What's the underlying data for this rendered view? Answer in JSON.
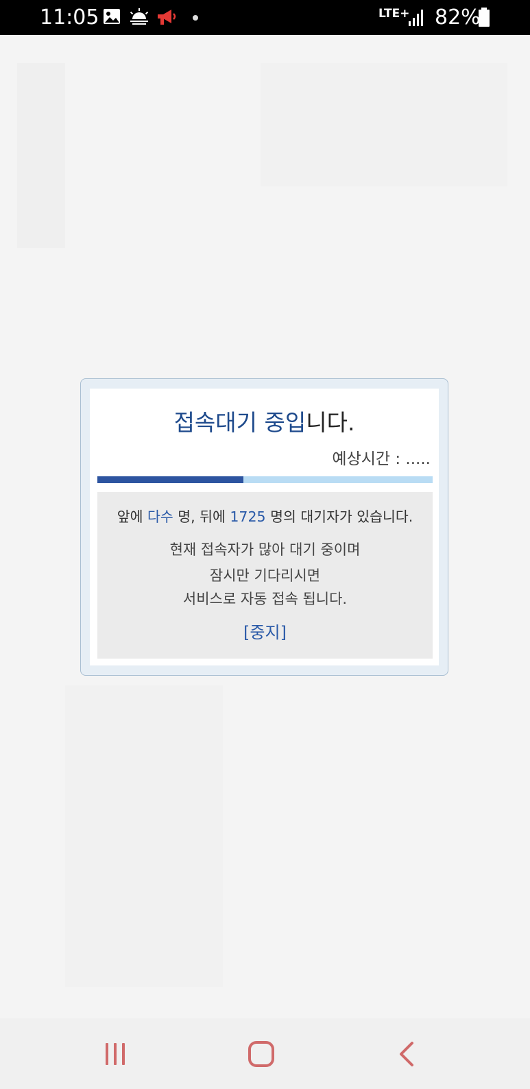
{
  "status_bar": {
    "time": "11:05",
    "network": "LTE+",
    "battery_percent": "82%",
    "icons": [
      "image-icon",
      "weather-icon",
      "megaphone-icon",
      "notification-dot-icon",
      "signal-icon",
      "battery-icon"
    ]
  },
  "dialog": {
    "title_highlight": "접속대기 중입",
    "title_rest": "니다.",
    "eta": "예상시간 : .....",
    "progress": 0.435,
    "queue": {
      "prefix": "앞에 ",
      "ahead": "다수",
      "middle": " 명, 뒤에 ",
      "behind": "1725",
      "suffix": " 명의 대기자가 있습니다."
    },
    "info_lines": [
      "현재 접속자가 많아 대기 중이며",
      "잠시만 기다리시면",
      "서비스로 자동 접속 됩니다."
    ],
    "stop_label": "[중지]"
  },
  "nav_bar": {
    "buttons": [
      "recent-apps",
      "home",
      "back"
    ]
  },
  "colors": {
    "accent": "#2d54a0",
    "progress_track": "#b9dcf4",
    "nav_icon": "#d06a6a"
  }
}
